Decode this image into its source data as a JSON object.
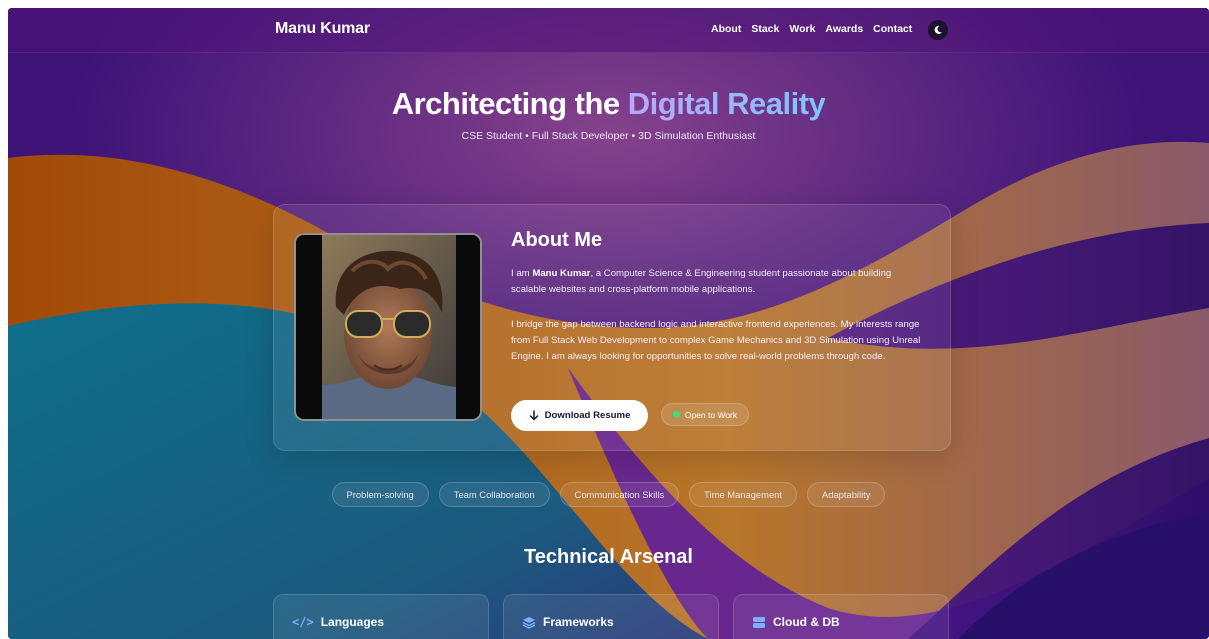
{
  "colors": {
    "background_purple": "#3b1274",
    "orange_wave": "#b8550a",
    "teal_wave": "#116d85",
    "accent_gradient_start": "#b9a7ff",
    "accent_gradient_end": "#7fc4ff",
    "status_green": "#3ddc84",
    "icon_blue": "#7fb0ff"
  },
  "nav": {
    "brand": "Manu Kumar",
    "links": [
      "About",
      "Stack",
      "Work",
      "Awards",
      "Contact"
    ],
    "theme_icon": "moon-icon"
  },
  "hero": {
    "title_main": "Architecting the",
    "title_accent": "Digital Reality",
    "subtitle": "CSE Student • Full Stack Developer • 3D Simulation Enthusiast"
  },
  "about": {
    "title": "About Me",
    "p1_prefix": "I am ",
    "p1_name": "Manu Kumar",
    "p1_rest": ", a Computer Science & Engineering student passionate about building scalable websites and cross-platform mobile applications.",
    "p2": "I bridge the gap between backend logic and interactive frontend experiences. My interests range from Full Stack Web Development to complex Game Mechanics and 3D Simulation using Unreal Engine. I am always looking for opportunities to solve real-world problems through code.",
    "download_label": "Download Resume",
    "download_icon": "arrow-down-icon",
    "status_label": "Open to Work",
    "photo_alt": "profile-photo"
  },
  "skills": [
    "Problem-solving",
    "Team Collaboration",
    "Communication Skills",
    "Time Management",
    "Adaptability"
  ],
  "arsenal": {
    "title": "Technical Arsenal",
    "cards": [
      {
        "label": "Languages",
        "icon": "code-icon"
      },
      {
        "label": "Frameworks",
        "icon": "layers-icon"
      },
      {
        "label": "Cloud & DB",
        "icon": "server-icon"
      }
    ]
  }
}
